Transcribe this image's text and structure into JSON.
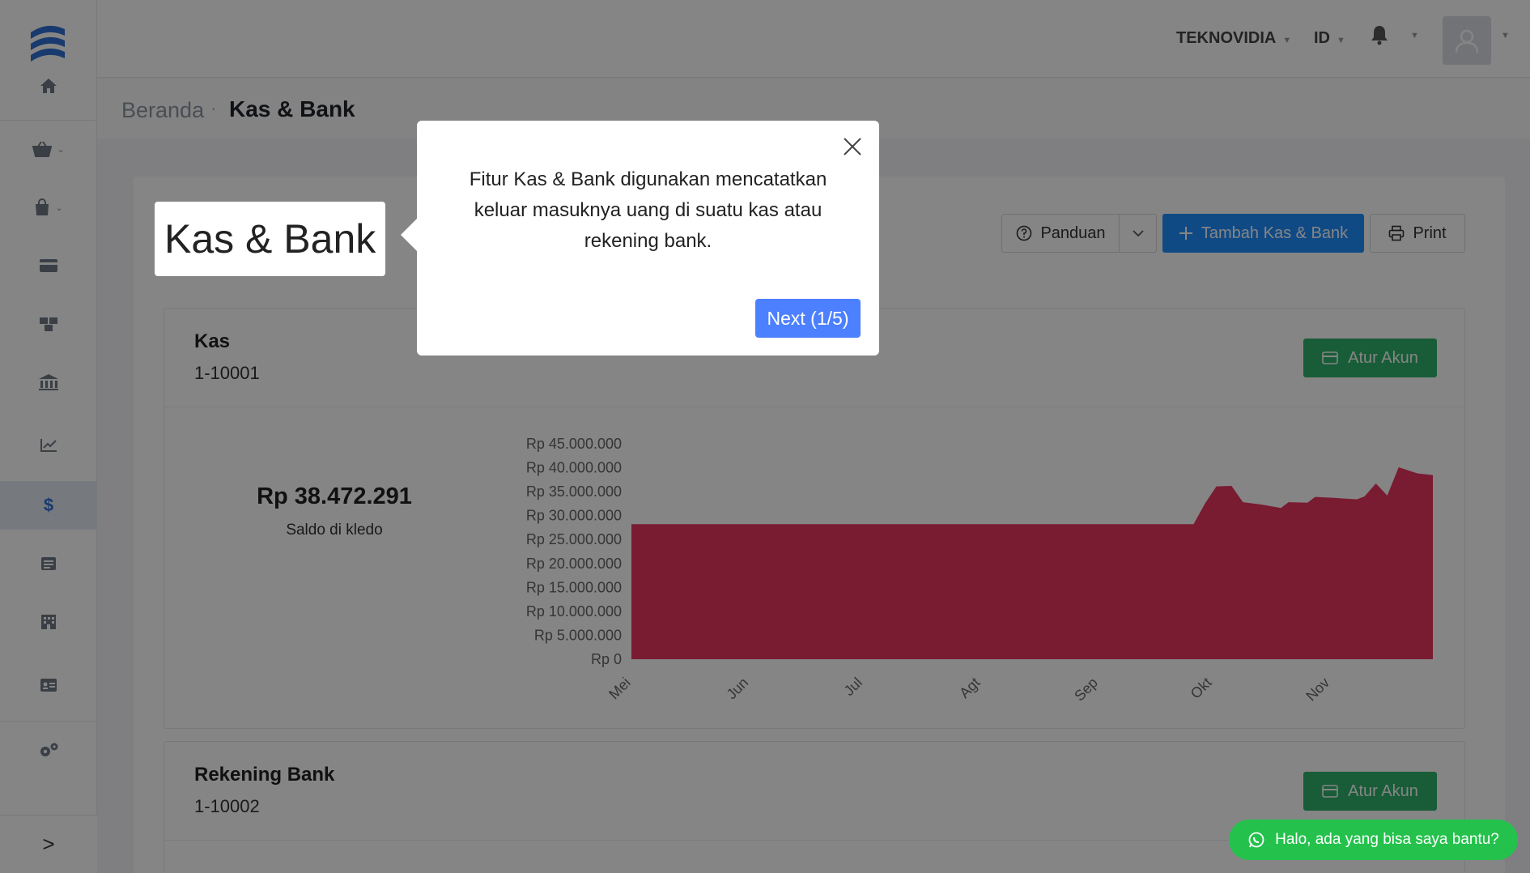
{
  "header": {
    "company": "TEKNOVIDIA",
    "language": "ID"
  },
  "breadcrumb": {
    "home": "Beranda",
    "separator": "·",
    "current": "Kas & Bank"
  },
  "page": {
    "title": "Kas & Bank",
    "guide_label": "Panduan",
    "add_label": "Tambah Kas & Bank",
    "print_label": "Print"
  },
  "sidebar": {
    "items": [
      {
        "icon": "home-icon"
      },
      {
        "icon": "basket-icon"
      },
      {
        "icon": "shopping-bag-icon"
      },
      {
        "icon": "credit-card-icon"
      },
      {
        "icon": "boxes-icon"
      },
      {
        "icon": "bank-icon"
      },
      {
        "icon": "chart-line-icon"
      },
      {
        "icon": "dollar-icon",
        "symbol": "$"
      },
      {
        "icon": "list-icon"
      },
      {
        "icon": "building-icon"
      },
      {
        "icon": "id-card-icon"
      },
      {
        "icon": "settings-icon"
      }
    ],
    "toggle": ">"
  },
  "accounts": [
    {
      "name": "Kas",
      "code": "1-10001",
      "button": "Atur Akun",
      "balance": "Rp 38.472.291",
      "balance_label": "Saldo di kledo"
    },
    {
      "name": "Rekening Bank",
      "code": "1-10002",
      "button": "Atur Akun"
    }
  ],
  "tour": {
    "text": "Fitur Kas & Bank digunakan mencatatkan keluar masuknya uang di suatu kas atau rekening bank.",
    "next_label": "Next (1/5)"
  },
  "chat": {
    "label": "Halo, ada yang bisa saya bantu?"
  },
  "colors": {
    "primary": "#1f8fff",
    "success": "#2fb36b",
    "chart_fill": "#e8345f",
    "tour_next": "#4c80ff",
    "whatsapp": "#24c24c"
  },
  "chart_data": {
    "type": "area",
    "x_categories": [
      "Mei",
      "Jun",
      "Jul",
      "Agt",
      "Sep",
      "Okt",
      "Nov"
    ],
    "y_ticks": [
      "Rp 45.000.000",
      "Rp 40.000.000",
      "Rp 35.000.000",
      "Rp 30.000.000",
      "Rp 25.000.000",
      "Rp 20.000.000",
      "Rp 15.000.000",
      "Rp 10.000.000",
      "Rp 5.000.000",
      "Rp 0"
    ],
    "ylim": [
      0,
      45000000
    ],
    "series": [
      {
        "points": [
          [
            "2023-05-01",
            28200000
          ],
          [
            "2023-09-26",
            28200000
          ],
          [
            "2023-09-29",
            32500000
          ],
          [
            "2023-10-02",
            36100000
          ],
          [
            "2023-10-06",
            36200000
          ],
          [
            "2023-10-09",
            32800000
          ],
          [
            "2023-10-14",
            32300000
          ],
          [
            "2023-10-19",
            31600000
          ],
          [
            "2023-10-21",
            32800000
          ],
          [
            "2023-10-26",
            32700000
          ],
          [
            "2023-10-28",
            33900000
          ],
          [
            "2023-11-02",
            33700000
          ],
          [
            "2023-11-08",
            33400000
          ],
          [
            "2023-11-10",
            34000000
          ],
          [
            "2023-11-13",
            36700000
          ],
          [
            "2023-11-16",
            34200000
          ],
          [
            "2023-11-19",
            40100000
          ],
          [
            "2023-11-24",
            38800000
          ],
          [
            "2023-11-28",
            38472291
          ]
        ]
      }
    ]
  }
}
